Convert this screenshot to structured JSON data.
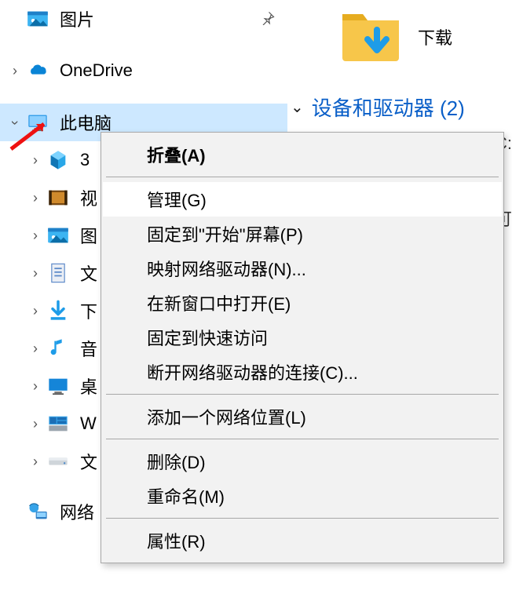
{
  "tree": {
    "pictures": {
      "label": "图片"
    },
    "onedrive": {
      "label": "OneDrive"
    },
    "thispc": {
      "label": "此电脑"
    },
    "child_3d": {
      "label": "3"
    },
    "child_vid": {
      "label": "视"
    },
    "child_pic": {
      "label": "图"
    },
    "child_doc": {
      "label": "文"
    },
    "child_dl": {
      "label": "下"
    },
    "child_mus": {
      "label": "音"
    },
    "child_dsk": {
      "label": "桌"
    },
    "child_w": {
      "label": "W"
    },
    "child_d": {
      "label": "文"
    },
    "network": {
      "label": "网络"
    }
  },
  "right": {
    "download_label": "下载",
    "section_label": "设备和驱动器 (2)",
    "edge_c": "C:",
    "edge_d": "可"
  },
  "menu": {
    "collapse": "折叠(A)",
    "manage": "管理(G)",
    "pin_start": "固定到\"开始\"屏幕(P)",
    "map_drive": "映射网络驱动器(N)...",
    "open_new_win": "在新窗口中打开(E)",
    "pin_quick": "固定到快速访问",
    "disconnect": "断开网络驱动器的连接(C)...",
    "add_netloc": "添加一个网络位置(L)",
    "delete": "删除(D)",
    "rename": "重命名(M)",
    "properties": "属性(R)"
  }
}
